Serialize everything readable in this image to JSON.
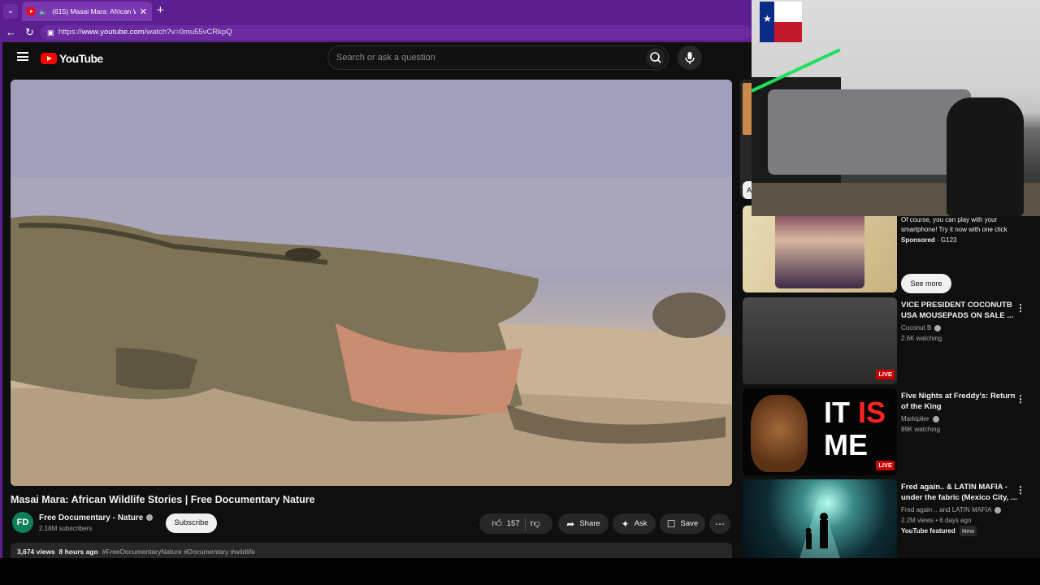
{
  "browser": {
    "tab_title": "(615) Masai Mara: African Wil",
    "url_prefix": "https://",
    "url_domain": "www.youtube.com",
    "url_path": "/watch?v=0mu55vCRkpQ"
  },
  "masthead": {
    "logo_text": "YouTube",
    "search_placeholder": "Search or ask a question"
  },
  "video": {
    "title": "Masai Mara: African Wildlife Stories | Free Documentary Nature",
    "channel": "Free Documentary - Nature",
    "subscribers": "2.18M subscribers",
    "subscribe_label": "Subscribe",
    "likes": "157",
    "share_label": "Share",
    "ask_label": "Ask",
    "save_label": "Save",
    "views": "3,674 views",
    "posted": "8 hours ago",
    "hashtags": "#FreeDocumentaryNature #Documentary #wildlife"
  },
  "sidebar": {
    "chip_peek": "A",
    "ad": {
      "text": "Of course, you can play with your smartphone! Try it now with one click",
      "sponsored": "Sponsored",
      "advertiser": "G123",
      "cta": "See more"
    },
    "recs": [
      {
        "title": "VICE PRESIDENT COCONUTB USA MOUSEPADS ON SALE ...",
        "channel": "Coconut B",
        "meta": "2.6K watching",
        "badge": "LIVE"
      },
      {
        "title": "Five Nights at Freddy's: Return of the King",
        "channel": "Markiplier",
        "meta": "89K watching",
        "badge": "LIVE",
        "thumb_text_1": "IT ",
        "thumb_text_2": "IS",
        "thumb_text_3": "ME"
      },
      {
        "title": "Fred again.. & LATIN MAFIA - under the fabric (Mexico City, ...",
        "channel": "Fred again .. and LATIN MAFIA",
        "meta": "2.2M views • 6 days ago",
        "featured": "YouTube featured",
        "new_badge": "New"
      }
    ]
  },
  "icons": {
    "avatar_text": "FD"
  }
}
